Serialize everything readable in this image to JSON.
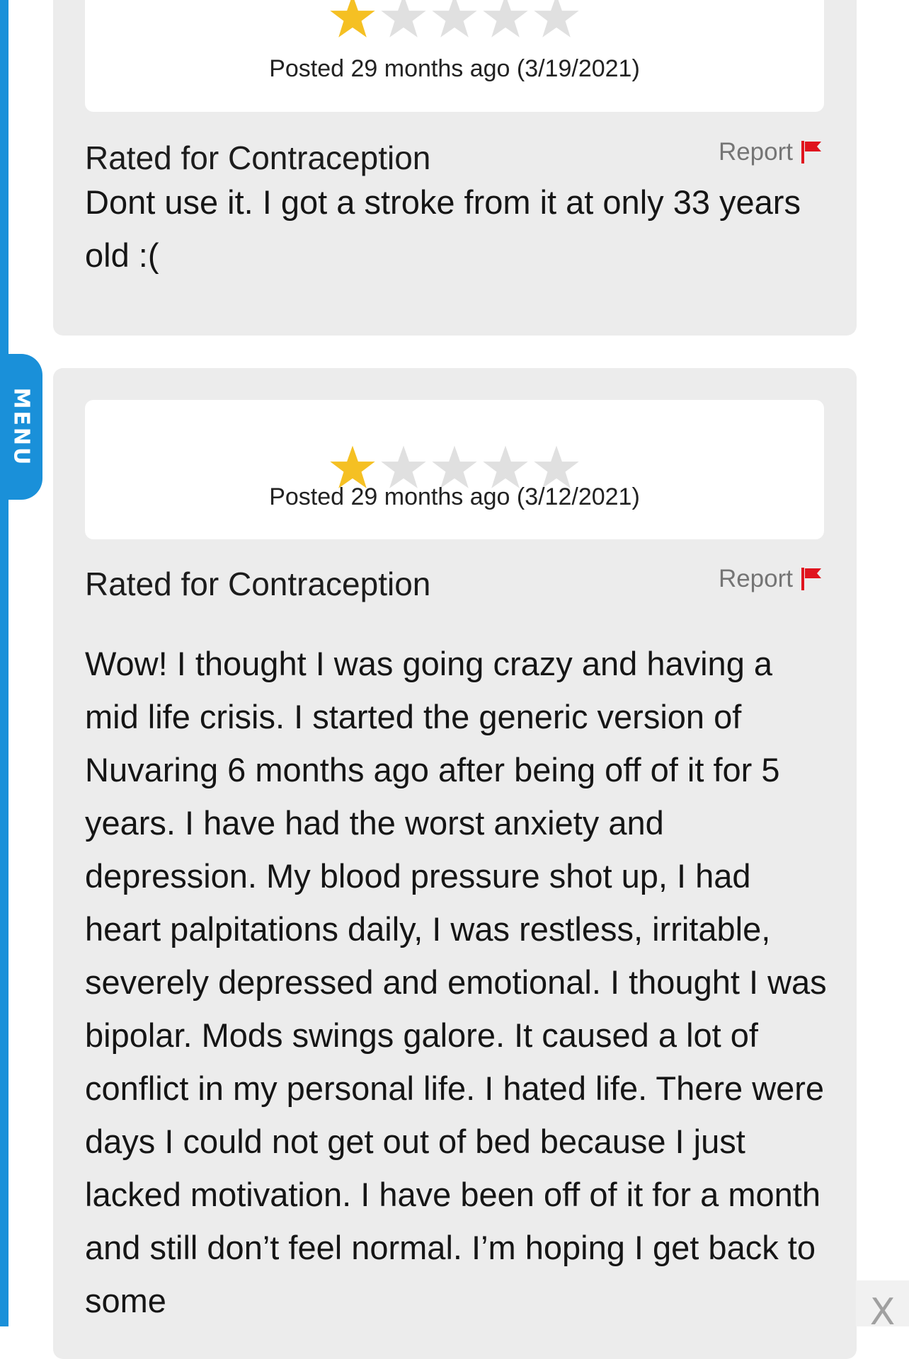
{
  "menu": {
    "label": "MENU"
  },
  "reviews": [
    {
      "rating": 1,
      "max_rating": 5,
      "posted": "Posted 29 months ago (3/19/2021)",
      "condition": "Rated for Contraception",
      "report_label": "Report",
      "text": "Dont use it. I got a stroke from it at only 33 years old :("
    },
    {
      "rating": 1,
      "max_rating": 5,
      "posted": "Posted 29 months ago (3/12/2021)",
      "condition": "Rated for Contraception",
      "report_label": "Report",
      "text": "Wow! I thought I was going crazy and having a mid life crisis. I started the generic version of Nuvaring 6 months ago after being off of it for 5 years. I have had the worst anxiety and depression. My blood pressure shot up, I had heart palpitations daily, I was restless, irritable, severely depressed and emotional. I thought I was bipolar. Mods swings galore. It caused a lot of conflict in my personal life. I hated life. There were days I could not get out of bed because I just lacked motivation. I have been off of it for a month and still don’t feel normal. I’m hoping I get back to some"
    }
  ],
  "close_label": "X",
  "colors": {
    "accent": "#1a90d9",
    "star_filled": "#f5c023",
    "star_empty": "#e0e0e0",
    "flag": "#e0141e",
    "card_bg": "#ececec"
  },
  "icons": {
    "star": "star-icon",
    "flag": "flag-icon",
    "close": "close-icon"
  }
}
